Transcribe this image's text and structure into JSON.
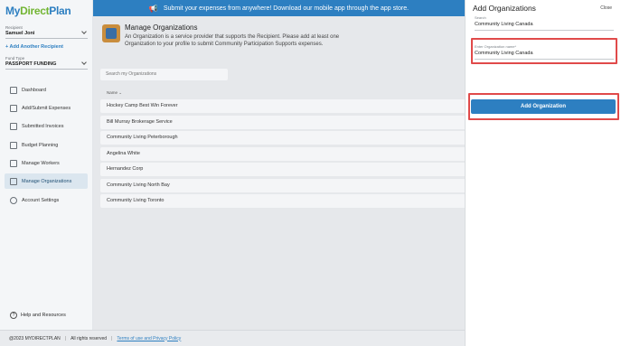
{
  "brand": {
    "my": "My",
    "direct": "Direct",
    "plan": "Plan"
  },
  "sidebar": {
    "recipient_label": "Recipient",
    "recipient_value": "Samuel Joni",
    "add_recipient": "+ Add Another Recipient",
    "fund_type_label": "Fund Type",
    "fund_type_value": "PASSPORT FUNDING",
    "items": [
      {
        "label": "Dashboard",
        "icon": "dashboard-icon"
      },
      {
        "label": "Add/Submit Expenses",
        "icon": "receipt-icon"
      },
      {
        "label": "Submitted Invoices",
        "icon": "invoice-icon"
      },
      {
        "label": "Budget Planning",
        "icon": "table-icon"
      },
      {
        "label": "Manage Workers",
        "icon": "workers-icon"
      },
      {
        "label": "Manage Organizations",
        "icon": "building-icon"
      },
      {
        "label": "Account Settings",
        "icon": "person-icon"
      }
    ],
    "active_item": "Manage Organizations",
    "help": "Help and Resources"
  },
  "banner": {
    "text": "Submit your expenses from anywhere! Download our mobile app through the app store."
  },
  "page": {
    "title": "Manage Organizations",
    "description": "An Organization is a service provider that supports the Recipient. Please add at least one Organization to your profile to submit Community Participation Supports expenses.",
    "search_placeholder": "Search my Organizations",
    "column_header": "Name",
    "organizations": [
      "Hockey Camp Best Win Forever",
      "Bill Murray Brokerage Service",
      "Community Living Peterborough",
      "Angelina White",
      "Hernandez Corp",
      "Community Living North Bay",
      "Community Living Toronto"
    ]
  },
  "footer": {
    "copyright": "@2023 MYDIRECTPLAN",
    "rights": "All rights reserved",
    "terms_link": "Terms of use and Privacy Policy"
  },
  "panel": {
    "title": "Add Organizations",
    "close": "Close",
    "search_label": "Search",
    "search_value": "Community Living Canada",
    "name_label": "Enter Organization name*",
    "name_value": "Community Living Canada",
    "button": "Add Organization"
  },
  "colors": {
    "accent": "#2d7fc1",
    "brand_green": "#72b533",
    "highlight": "#e04a4a"
  }
}
